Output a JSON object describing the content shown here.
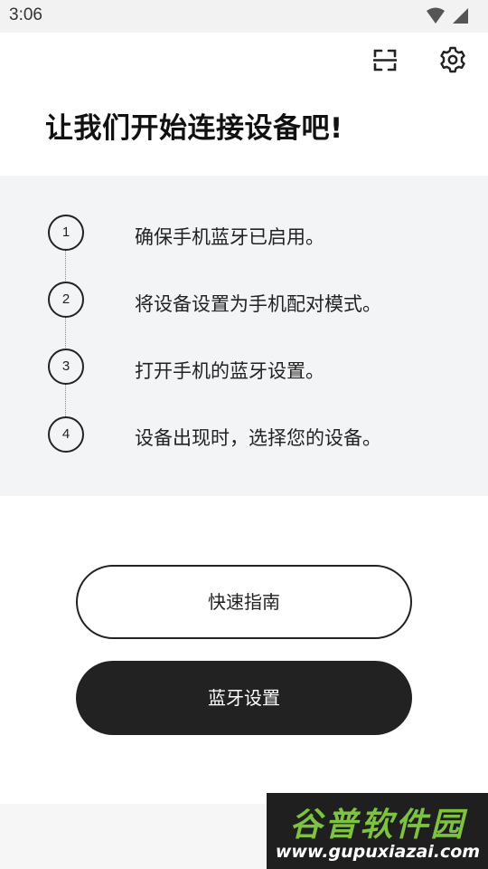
{
  "status_bar": {
    "time": "3:06",
    "icons": [
      "wifi-icon",
      "signal-icon"
    ]
  },
  "top_bar": {
    "icons": [
      "scan-icon",
      "gear-icon"
    ]
  },
  "page": {
    "title": "让我们开始连接设备吧!"
  },
  "steps": [
    {
      "number": "1",
      "text": "确保手机蓝牙已启用。"
    },
    {
      "number": "2",
      "text": "将设备设置为手机配对模式。"
    },
    {
      "number": "3",
      "text": "打开手机的蓝牙设置。"
    },
    {
      "number": "4",
      "text": "设备出现时，选择您的设备。"
    }
  ],
  "buttons": {
    "quick_guide": "快速指南",
    "bluetooth_settings": "蓝牙设置"
  },
  "watermark": {
    "title": "谷普软件园",
    "url": "www.gupuxiazai.com"
  },
  "colors": {
    "text": "#222222",
    "steps_background": "#f3f4f6",
    "primary_button": "#222222",
    "watermark_green": "#7ec241"
  }
}
